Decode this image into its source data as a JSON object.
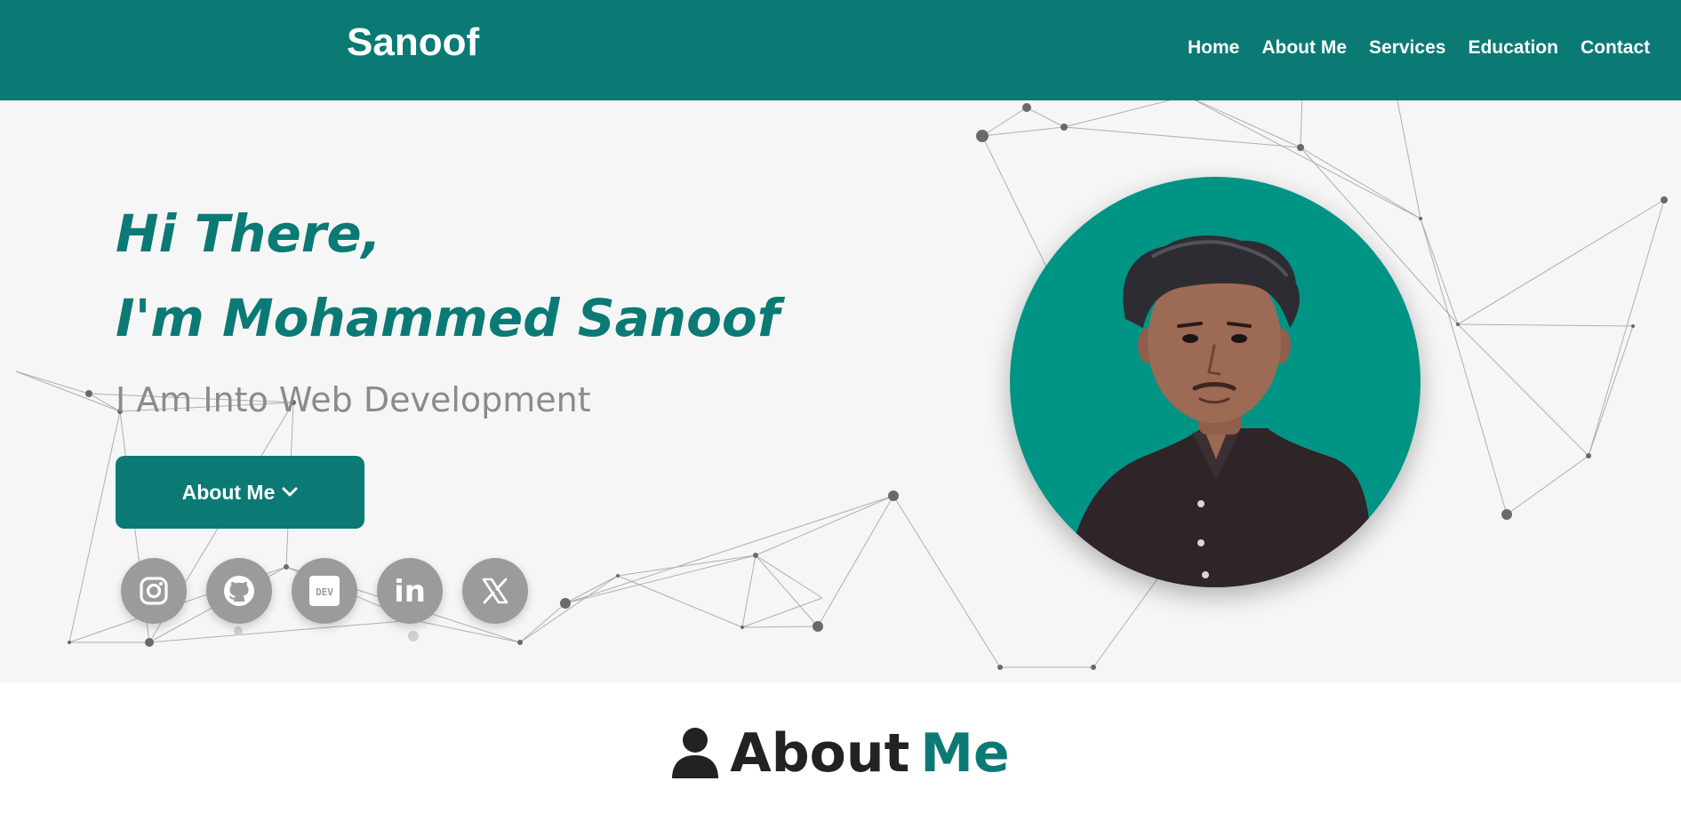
{
  "brand": "Sanoof",
  "nav": [
    {
      "label": "Home"
    },
    {
      "label": "About Me"
    },
    {
      "label": "Services"
    },
    {
      "label": "Education"
    },
    {
      "label": "Contact"
    }
  ],
  "hero": {
    "greeting_line1": "Hi There,",
    "greeting_line2": "I'm Mohammed Sanoof",
    "tagline": "I Am Into Web Development",
    "button_label": "About Me",
    "button_icon": "chevron-down-icon",
    "socials": [
      {
        "name": "instagram-icon"
      },
      {
        "name": "github-icon"
      },
      {
        "name": "dev-icon"
      },
      {
        "name": "linkedin-icon"
      },
      {
        "name": "x-icon"
      }
    ],
    "dev_badge": "DEV",
    "linkedin_badge": "in"
  },
  "about": {
    "heading_main": "About",
    "heading_accent": "Me",
    "icon": "user-icon"
  },
  "colors": {
    "accent": "#0b7a75",
    "portrait_bg": "#009485",
    "hero_bg": "#f6f6f6",
    "tagline": "#8b8b8b",
    "social_bg": "#9b9b9d"
  }
}
